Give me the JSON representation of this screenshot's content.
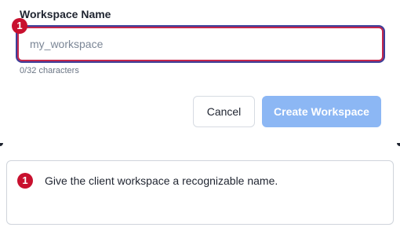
{
  "form": {
    "label": "Workspace Name",
    "input": {
      "value": "",
      "placeholder": "my_workspace"
    },
    "char_count": "0/32 characters",
    "step_badge": "1"
  },
  "actions": {
    "cancel_label": "Cancel",
    "create_label": "Create Workspace"
  },
  "instruction": {
    "step_badge": "1",
    "text": "Give the client workspace a recognizable name."
  },
  "colors": {
    "badge": "#c8102e",
    "input_focus_ring": "#3d3f9a",
    "primary_disabled": "#8cb7f4"
  }
}
